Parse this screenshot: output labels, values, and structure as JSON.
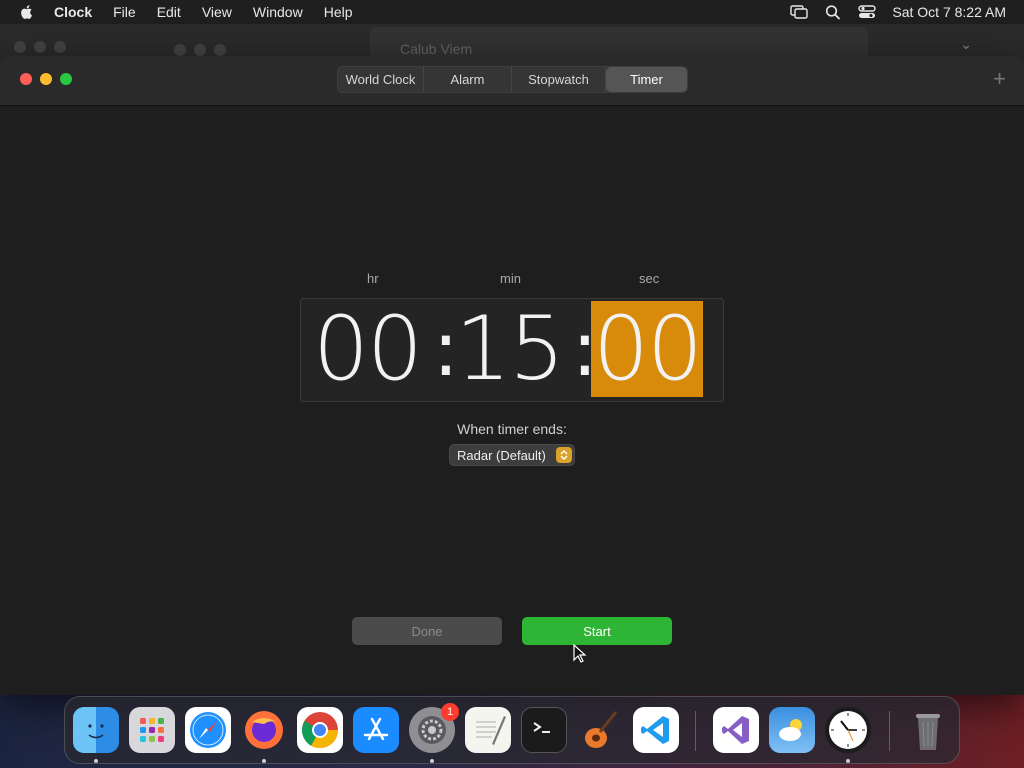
{
  "menubar": {
    "app_name": "Clock",
    "items": [
      "File",
      "Edit",
      "View",
      "Window",
      "Help"
    ],
    "datetime": "Sat Oct 7  8:22 AM"
  },
  "background_window": {
    "tab_title": "Calub Viem"
  },
  "tabs": [
    {
      "label": "World Clock",
      "active": false
    },
    {
      "label": "Alarm",
      "active": false
    },
    {
      "label": "Stopwatch",
      "active": false
    },
    {
      "label": "Timer",
      "active": true
    }
  ],
  "timer": {
    "hr_label": "hr",
    "min_label": "min",
    "sec_label": "sec",
    "hours": "00",
    "minutes": "15",
    "seconds": "00",
    "separator": ":",
    "ends_label": "When timer ends:",
    "sound": "Radar (Default)",
    "accent_color": "#d88a0a"
  },
  "buttons": {
    "done": "Done",
    "start": "Start"
  },
  "dock": {
    "apps": [
      {
        "name": "Finder",
        "running": true
      },
      {
        "name": "Launchpad",
        "running": false
      },
      {
        "name": "Safari",
        "running": false
      },
      {
        "name": "Firefox",
        "running": true
      },
      {
        "name": "Chrome",
        "running": false
      },
      {
        "name": "App Store",
        "running": false
      },
      {
        "name": "System Settings",
        "running": true,
        "badge": "1"
      },
      {
        "name": "TextEdit",
        "running": false
      },
      {
        "name": "Terminal",
        "running": false
      },
      {
        "name": "GarageBand",
        "running": false
      },
      {
        "name": "Visual Studio Code",
        "running": false
      },
      {
        "name": "Visual Studio",
        "running": false
      },
      {
        "name": "Weather",
        "running": false
      },
      {
        "name": "Clock",
        "running": true
      },
      {
        "name": "Trash",
        "running": false
      }
    ]
  }
}
